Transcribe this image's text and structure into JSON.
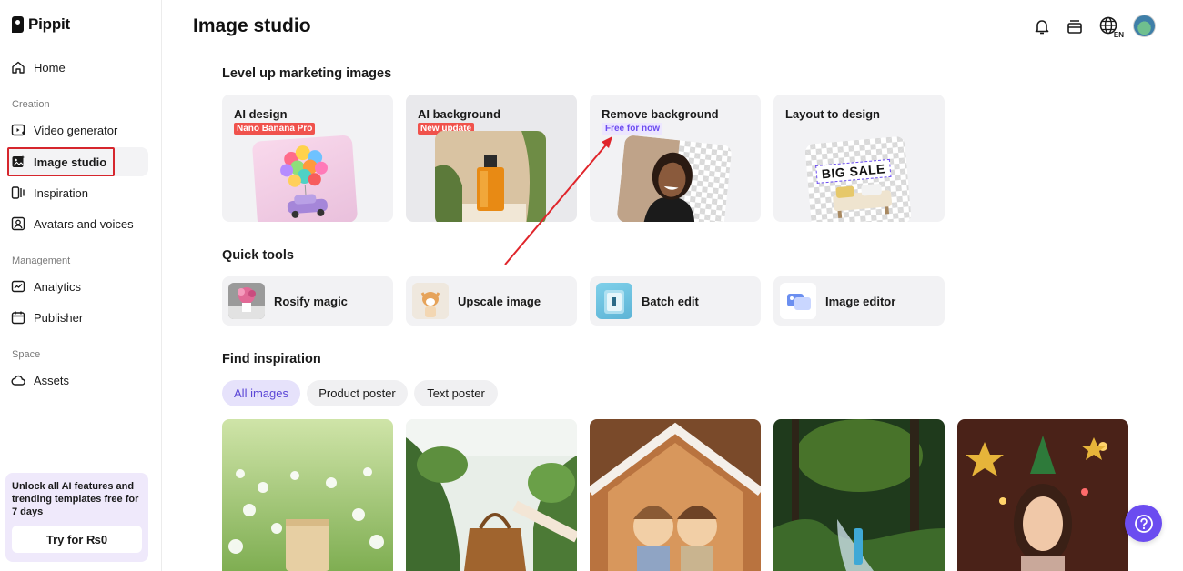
{
  "app": {
    "logo_text": "Pippit"
  },
  "sidebar": {
    "home": "Home",
    "section_creation": "Creation",
    "video_generator": "Video generator",
    "image_studio": "Image studio",
    "inspiration": "Inspiration",
    "avatars": "Avatars and voices",
    "section_management": "Management",
    "analytics": "Analytics",
    "publisher": "Publisher",
    "section_space": "Space",
    "assets": "Assets",
    "promo_text": "Unlock all AI features and trending templates free for 7 days",
    "promo_button": "Try for ₨0"
  },
  "header": {
    "title": "Image studio",
    "lang_code": "EN",
    "icons": [
      "bell-icon",
      "inbox-icon",
      "globe-icon",
      "avatar"
    ]
  },
  "marketing": {
    "heading": "Level up marketing images",
    "cards": [
      {
        "title": "AI design",
        "badge": "Nano Banana Pro"
      },
      {
        "title": "AI background",
        "badge": "New update"
      },
      {
        "title": "Remove background",
        "badge": "Free for now"
      },
      {
        "title": "Layout to design",
        "badge": ""
      }
    ],
    "layout_art_text": "BIG SALE"
  },
  "quick_tools": {
    "heading": "Quick tools",
    "items": [
      {
        "label": "Rosify magic"
      },
      {
        "label": "Upscale image"
      },
      {
        "label": "Batch edit"
      },
      {
        "label": "Image editor"
      }
    ]
  },
  "inspiration": {
    "heading": "Find inspiration",
    "chips": [
      "All images",
      "Product poster",
      "Text poster"
    ],
    "selected_chip": "All images"
  },
  "colors": {
    "accent": "#6b4cf0",
    "highlight_outline": "#d6262d",
    "badge_red": "#f0524c",
    "annotation_arrow": "#e0252b"
  }
}
